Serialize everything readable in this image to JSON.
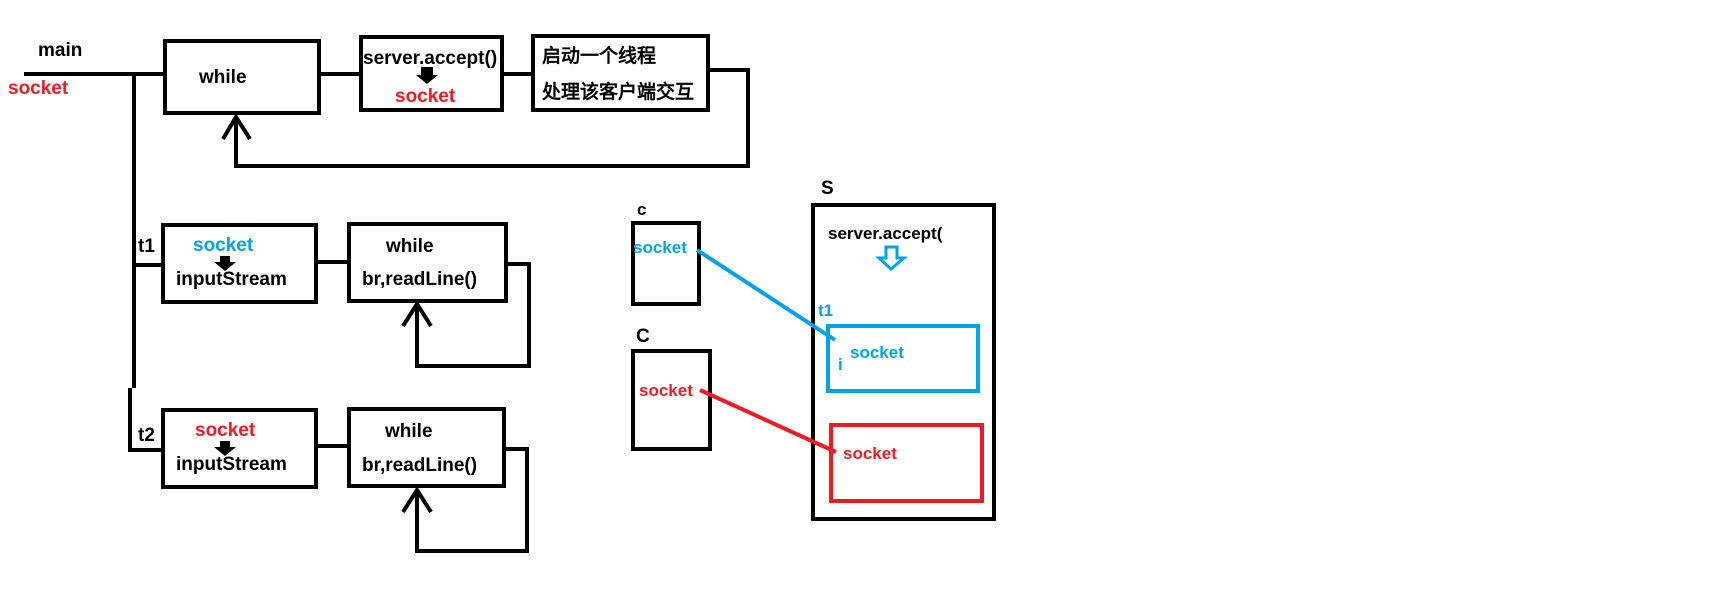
{
  "colors": {
    "ink": "#000000",
    "red": "#ed1c24",
    "blue": "#00a2e8"
  },
  "main": {
    "label": "main",
    "socket_label": "socket",
    "loop_label": "while",
    "accept_label": "server.accept()",
    "accept_result": "socket",
    "thread_line1": "启动一个线程",
    "thread_line2": "处理该客户端交互"
  },
  "t1": {
    "label": "t1",
    "socket_label": "socket",
    "stream_label": "inputStream",
    "loop_label": "while",
    "read_label": "br,readLine()"
  },
  "t2": {
    "label": "t2",
    "socket_label": "socket",
    "stream_label": "inputStream",
    "loop_label": "while",
    "read_label": "br,readLine()"
  },
  "client1": {
    "label": "c",
    "socket_label": "socket"
  },
  "client2": {
    "label": "C",
    "socket_label": "socket"
  },
  "server": {
    "label": "S",
    "accept_label": "server.accept(",
    "thread_label": "t1",
    "thread_marker": "i",
    "socket1_label": "socket",
    "socket2_label": "socket"
  }
}
